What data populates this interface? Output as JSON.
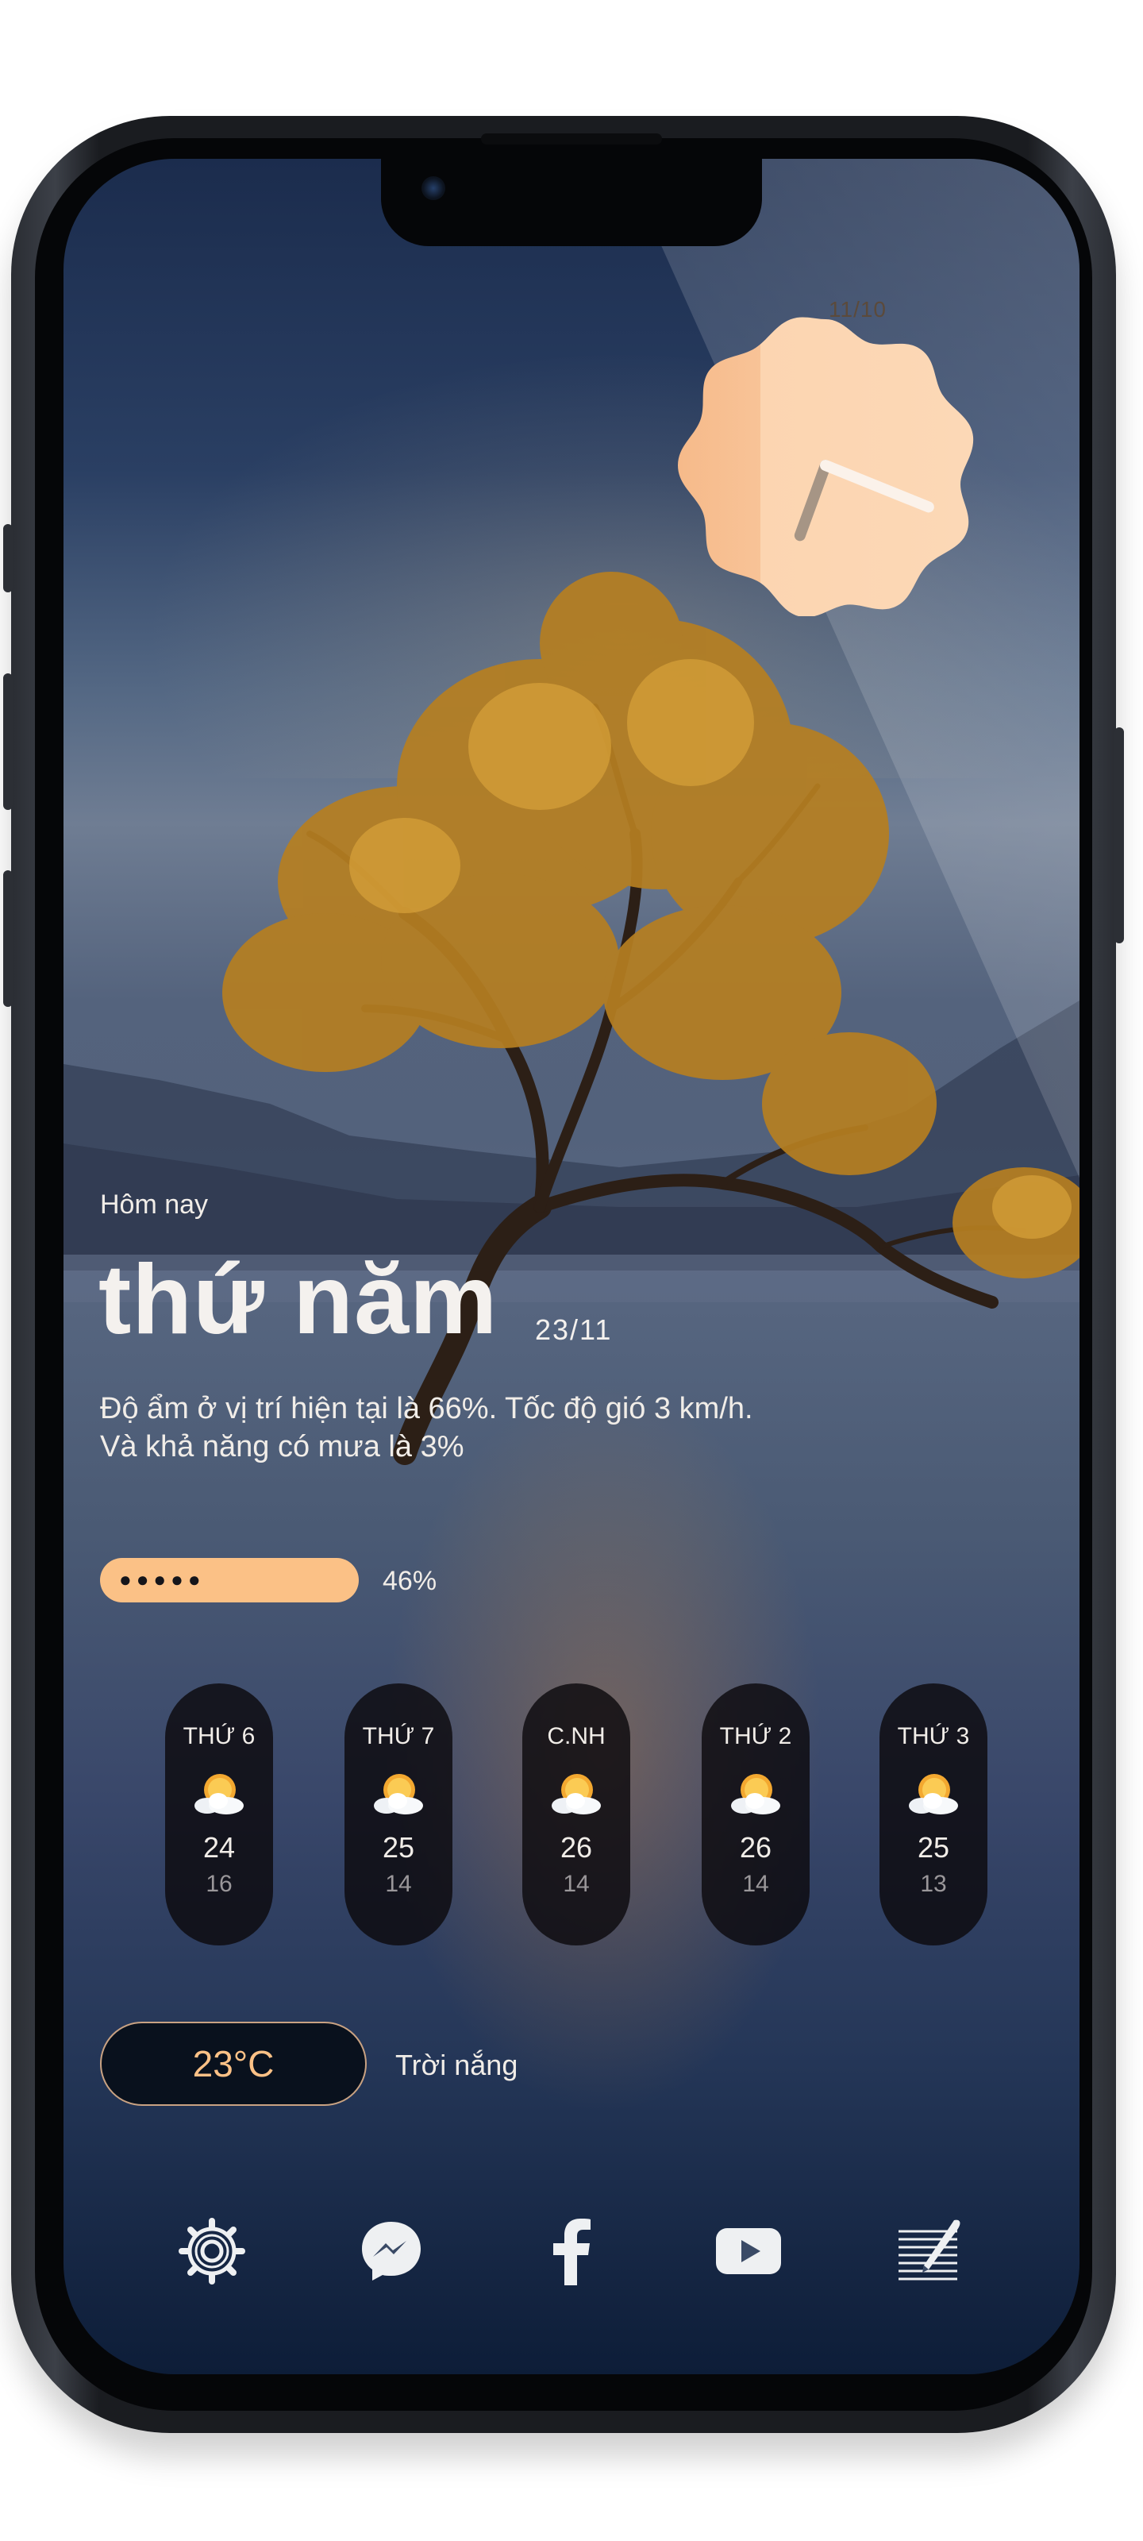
{
  "clock": {
    "date": "11/10",
    "hour_deg": 200,
    "minute_deg": 112
  },
  "today": {
    "label": "Hôm nay",
    "day": "thứ năm",
    "date": "23/11",
    "description_line1": "Độ ẩm ở vị trí hiện tại là 66%. Tốc độ gió 3 km/h.",
    "description_line2": "Và khả năng có mưa là 3%"
  },
  "battery": {
    "dots": "●●●●●",
    "level": 46,
    "text": "46%"
  },
  "forecast": [
    {
      "day": "THỨ 6",
      "icon": "sun-cloud-icon",
      "high": "24",
      "low": "16"
    },
    {
      "day": "THỨ 7",
      "icon": "sun-cloud-icon",
      "high": "25",
      "low": "14"
    },
    {
      "day": "C.NH",
      "icon": "sun-cloud-icon",
      "high": "26",
      "low": "14"
    },
    {
      "day": "THỨ 2",
      "icon": "sun-cloud-icon",
      "high": "26",
      "low": "14"
    },
    {
      "day": "THỨ 3",
      "icon": "sun-cloud-icon",
      "high": "25",
      "low": "13"
    }
  ],
  "current": {
    "temperature": "23°C",
    "condition": "Trời nắng"
  },
  "dock": [
    {
      "name": "settings",
      "icon": "gear-icon"
    },
    {
      "name": "messenger",
      "icon": "messenger-icon"
    },
    {
      "name": "facebook",
      "icon": "facebook-icon"
    },
    {
      "name": "youtube",
      "icon": "youtube-icon"
    },
    {
      "name": "notes",
      "icon": "notes-icon"
    }
  ],
  "colors": {
    "accent": "#fbc186",
    "clock_face": "#fcd3ae",
    "pill_bg": "#09111d"
  }
}
